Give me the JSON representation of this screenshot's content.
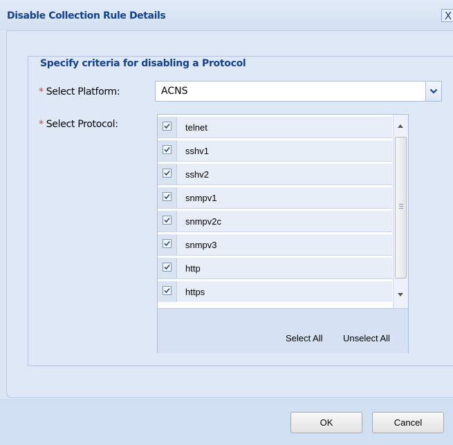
{
  "dialog": {
    "title": "Disable Collection Rule Details",
    "close_glyph": "X"
  },
  "form": {
    "legend": "Specify criteria for disabling a Protocol",
    "required_marker": "*",
    "platform_label": "Select Platform:",
    "platform_value": "ACNS",
    "protocol_label": "Select Protocol:"
  },
  "protocols": [
    {
      "label": "telnet",
      "checked": true
    },
    {
      "label": "sshv1",
      "checked": true
    },
    {
      "label": "sshv2",
      "checked": true
    },
    {
      "label": "snmpv1",
      "checked": true
    },
    {
      "label": "snmpv2c",
      "checked": true
    },
    {
      "label": "snmpv3",
      "checked": true
    },
    {
      "label": "http",
      "checked": true
    },
    {
      "label": "https",
      "checked": true
    }
  ],
  "protocol_actions": {
    "select_all": "Select All",
    "unselect_all": "Unselect All"
  },
  "buttons": {
    "ok": "OK",
    "cancel": "Cancel"
  },
  "colors": {
    "title": "#15428b",
    "required": "#e23b2a",
    "panel_bg": "#dee8f6"
  },
  "icons": {
    "close": "close-icon",
    "dropdown": "chevron-down-icon",
    "checkbox": "checkmark-icon",
    "scroll_up": "scroll-up-arrow-icon",
    "scroll_down": "scroll-down-arrow-icon"
  }
}
